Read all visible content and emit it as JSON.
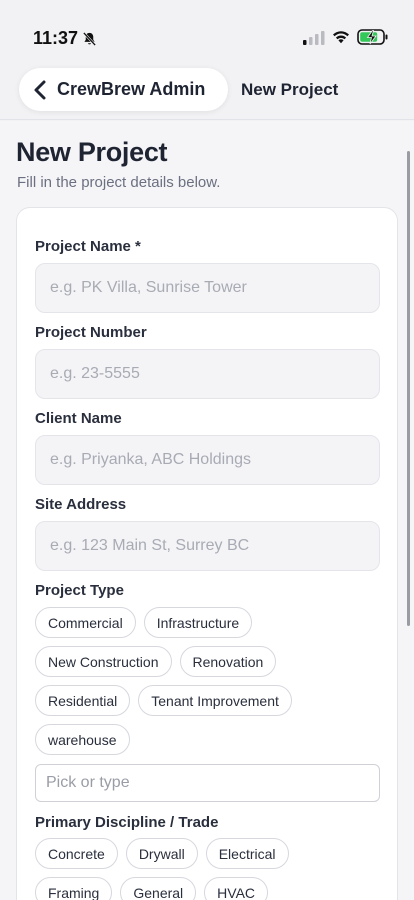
{
  "status_bar": {
    "time": "11:37",
    "icons": [
      "bell-muted-icon",
      "signal-icon",
      "wifi-icon",
      "battery-charging-icon"
    ],
    "battery_color": "#34c759"
  },
  "nav": {
    "back_label": "CrewBrew Admin",
    "title": "New Project"
  },
  "page": {
    "title": "New Project",
    "subtitle": "Fill in the project details below."
  },
  "form": {
    "project_name": {
      "label": "Project Name *",
      "placeholder": "e.g. PK Villa, Sunrise Tower",
      "value": ""
    },
    "project_number": {
      "label": "Project Number",
      "placeholder": "e.g. 23-5555",
      "value": ""
    },
    "client_name": {
      "label": "Client Name",
      "placeholder": "e.g. Priyanka, ABC Holdings",
      "value": ""
    },
    "site_address": {
      "label": "Site Address",
      "placeholder": "e.g. 123 Main St, Surrey BC",
      "value": ""
    },
    "project_type": {
      "label": "Project Type",
      "options": [
        "Commercial",
        "Infrastructure",
        "New Construction",
        "Renovation",
        "Residential",
        "Tenant Improvement",
        "warehouse"
      ],
      "input_placeholder": "Pick or type"
    },
    "primary_discipline": {
      "label": "Primary Discipline / Trade",
      "options": [
        "Concrete",
        "Drywall",
        "Electrical",
        "Framing",
        "General",
        "HVAC"
      ]
    }
  }
}
